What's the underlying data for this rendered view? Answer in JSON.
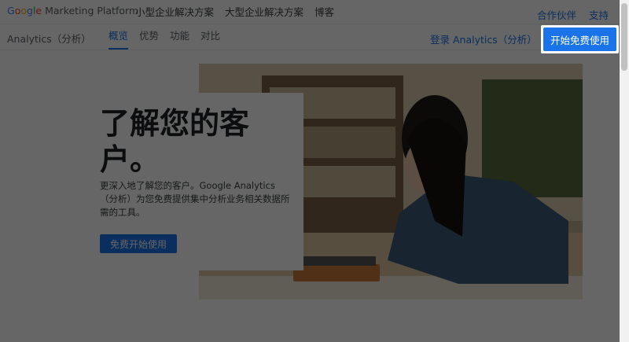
{
  "header": {
    "logo_text": "Marketing Platform",
    "nav": [
      "小型企业解决方案",
      "大型企业解决方案",
      "博客"
    ],
    "right_links": [
      "合作伙伴",
      "支持"
    ]
  },
  "subnav": {
    "product": "Analytics（分析）",
    "tabs": [
      "概览",
      "优势",
      "功能",
      "对比"
    ],
    "login": "登录 Analytics（分析）",
    "cta": "开始免费使用"
  },
  "hero": {
    "title": "了解您的客户。",
    "description": "更深入地了解您的客户。Google Analytics（分析）为您免费提供集中分析业务相关数据所需的工具。",
    "button": "免费开始使用"
  }
}
